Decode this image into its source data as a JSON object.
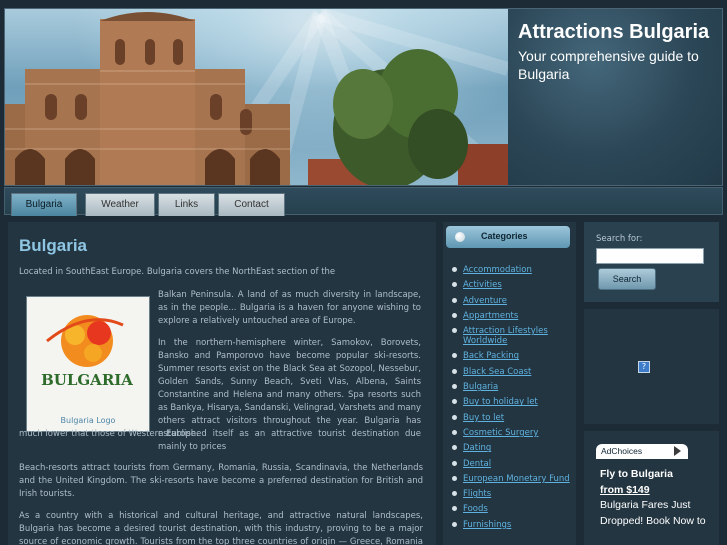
{
  "header": {
    "title": "Attractions Bulgaria",
    "tagline": "Your comprehensive guide to Bulgaria"
  },
  "nav": {
    "tabs": [
      {
        "label": "Bulgaria",
        "active": true
      },
      {
        "label": "Weather",
        "active": false
      },
      {
        "label": "Links",
        "active": false
      },
      {
        "label": "Contact",
        "active": false
      }
    ]
  },
  "main": {
    "title": "Bulgaria",
    "intro": "Located in SouthEast Europe. Bulgaria covers the NorthEast section of the",
    "para1": "Balkan Peninsula.  A land of as much diversity in landscape, as in the people... Bulgaria is a haven for anyone wishing to explore a relatively untouched area of Europe.",
    "para2": "In the northern-hemisphere winter, Samokov, Borovets, Bansko and Pamporovo have become popular ski-resorts.  Summer resorts exist on the Black Sea at Sozopol, Nessebur, Golden Sands, Sunny Beach, Sveti Vlas, Albena, Saints Constantine and Helena and many others. Spa resorts such as Bankya, Hisarya, Sandanski, Velingrad, Varshets and many others attract visitors throughout the year. Bulgaria has established itself as an attractive tourist destination due mainly to prices",
    "para2_tail": "much lower that those of Western Europe.",
    "para3": "Beach-resorts attract tourists from Germany, Romania, Russia, Scandinavia, the Netherlands and the United Kingdom. The ski-resorts have become a preferred destination for British and Irish tourists.",
    "para4": "As a country with a historical and cultural heritage, and attractive natural landscapes, Bulgaria has become a desired tourist destination, with this  industry, proving to be a major source of economic growth. Tourists from the top three countries of origin — Greece, Romania and",
    "logo": {
      "wordmark": "BULGARIA",
      "caption": "Bulgaria Logo"
    }
  },
  "categories": {
    "title": "Categories",
    "items": [
      "Accommodation",
      "Activities",
      "Adventure",
      "Appartments",
      "Attraction Lifestyles Worldwide",
      "Back Packing",
      "Black Sea Coast",
      "Bulgaria",
      "Buy to holiday let",
      "Buy to let",
      "Cosmetic Surgery",
      "Dating",
      "Dental",
      "European Monetary Fund",
      "Flights",
      "Foods",
      "Furnishings"
    ]
  },
  "search": {
    "label": "Search for:",
    "value": "",
    "button": "Search"
  },
  "ads": {
    "adchoices": "AdChoices",
    "headline": "Fly to Bulgaria",
    "link": "from $149",
    "body": "Bulgaria Fares Just Dropped! Book Now to"
  },
  "colors": {
    "background": "#1c2b35",
    "panel": "#233541",
    "title_accent": "#8ec6e3",
    "link": "#5fb2e0",
    "tab_active": "#4b85a0"
  }
}
